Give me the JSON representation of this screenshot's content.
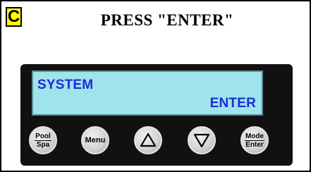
{
  "header": {
    "badge_letter": "C",
    "title": "PRESS \"ENTER\""
  },
  "display": {
    "line1": "SYSTEM",
    "line2": "ENTER"
  },
  "buttons": {
    "pool_spa": {
      "top": "Pool",
      "bottom": "Spa"
    },
    "menu": "Menu",
    "up_icon": "triangle-up-icon",
    "down_icon": "triangle-down-icon",
    "mode_enter": {
      "top": "Mode",
      "bottom": "Enter"
    }
  },
  "colors": {
    "badge": "#ffff00",
    "lcd_background": "#9fe3ec",
    "lcd_text": "#1a2bd9",
    "panel": "#111111"
  }
}
